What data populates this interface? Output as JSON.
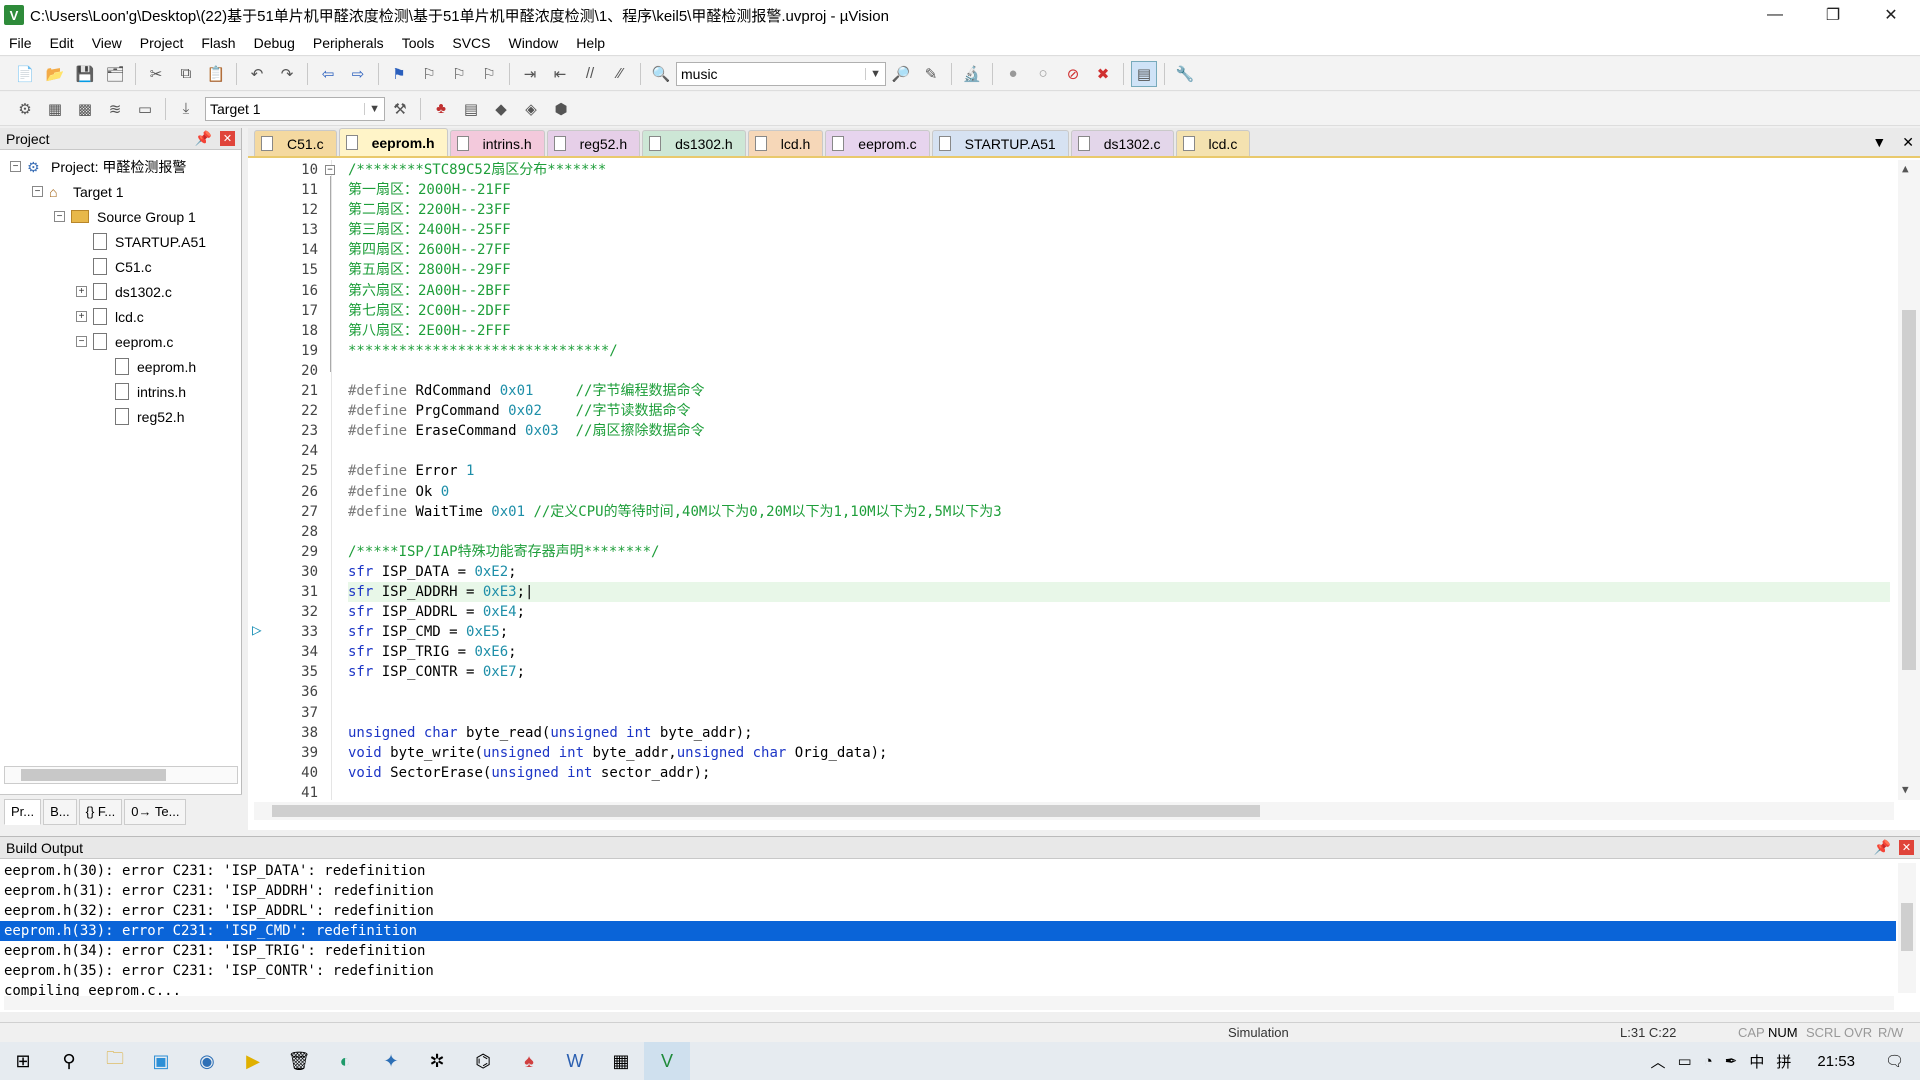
{
  "window": {
    "title": "C:\\Users\\Loon'g\\Desktop\\(22)基于51单片机甲醛浓度检测\\基于51单片机甲醛浓度检测\\1、程序\\keil5\\甲醛检测报警.uvproj - µVision",
    "icon": "V"
  },
  "menu": [
    "File",
    "Edit",
    "View",
    "Project",
    "Flash",
    "Debug",
    "Peripherals",
    "Tools",
    "SVCS",
    "Window",
    "Help"
  ],
  "toolbar": {
    "find_combo": "music"
  },
  "build_toolbar": {
    "target_combo": "Target 1"
  },
  "project_panel": {
    "title": "Project",
    "tree": [
      {
        "label": "Project: 甲醛检测报警",
        "depth": 0,
        "expander": "⊟",
        "icon": "project"
      },
      {
        "label": "Target 1",
        "depth": 1,
        "expander": "⊟",
        "icon": "target"
      },
      {
        "label": "Source Group 1",
        "depth": 2,
        "expander": "⊟",
        "icon": "folder"
      },
      {
        "label": "STARTUP.A51",
        "depth": 3,
        "expander": "",
        "icon": "file"
      },
      {
        "label": "C51.c",
        "depth": 3,
        "expander": "",
        "icon": "file"
      },
      {
        "label": "ds1302.c",
        "depth": 3,
        "expander": "⊞",
        "icon": "file"
      },
      {
        "label": "lcd.c",
        "depth": 3,
        "expander": "⊞",
        "icon": "file"
      },
      {
        "label": "eeprom.c",
        "depth": 3,
        "expander": "⊟",
        "icon": "file"
      },
      {
        "label": "eeprom.h",
        "depth": 4,
        "expander": "",
        "icon": "file"
      },
      {
        "label": "intrins.h",
        "depth": 4,
        "expander": "",
        "icon": "file"
      },
      {
        "label": "reg52.h",
        "depth": 4,
        "expander": "",
        "icon": "file"
      }
    ],
    "tabs": [
      "Pr...",
      "B...",
      "{} F...",
      "0→ Te..."
    ]
  },
  "editor": {
    "tabs": [
      {
        "label": "C51.c",
        "color": "#f4d9a0"
      },
      {
        "label": "eeprom.h",
        "color": "#fff0c0",
        "active": true
      },
      {
        "label": "intrins.h",
        "color": "#f3c9dc"
      },
      {
        "label": "reg52.h",
        "color": "#e6cfe8"
      },
      {
        "label": "ds1302.h",
        "color": "#cde7d6"
      },
      {
        "label": "lcd.h",
        "color": "#f6d7b8"
      },
      {
        "label": "eeprom.c",
        "color": "#e7d4ee"
      },
      {
        "label": "STARTUP.A51",
        "color": "#d6e2f2"
      },
      {
        "label": "ds1302.c",
        "color": "#e3d6ea"
      },
      {
        "label": "lcd.c",
        "color": "#f4e2b0"
      }
    ],
    "current_line": 31,
    "lines": [
      {
        "n": "10",
        "parts": [
          [
            "cm",
            "/********STC89C52扇区分布*******"
          ]
        ]
      },
      {
        "n": "11",
        "parts": [
          [
            "cm",
            "第一扇区：2000H--21FF"
          ]
        ]
      },
      {
        "n": "12",
        "parts": [
          [
            "cm",
            "第二扇区：2200H--23FF"
          ]
        ]
      },
      {
        "n": "13",
        "parts": [
          [
            "cm",
            "第三扇区：2400H--25FF"
          ]
        ]
      },
      {
        "n": "14",
        "parts": [
          [
            "cm",
            "第四扇区：2600H--27FF"
          ]
        ]
      },
      {
        "n": "15",
        "parts": [
          [
            "cm",
            "第五扇区：2800H--29FF"
          ]
        ]
      },
      {
        "n": "16",
        "parts": [
          [
            "cm",
            "第六扇区：2A00H--2BFF"
          ]
        ]
      },
      {
        "n": "17",
        "parts": [
          [
            "cm",
            "第七扇区：2C00H--2DFF"
          ]
        ]
      },
      {
        "n": "18",
        "parts": [
          [
            "cm",
            "第八扇区：2E00H--2FFF"
          ]
        ]
      },
      {
        "n": "19",
        "parts": [
          [
            "cm",
            "*******************************/"
          ]
        ]
      },
      {
        "n": "20",
        "parts": []
      },
      {
        "n": "21",
        "parts": [
          [
            "pp",
            "#define "
          ],
          [
            "t",
            "RdCommand "
          ],
          [
            "num",
            "0x01"
          ],
          [
            "t",
            "     "
          ],
          [
            "cm",
            "//字节编程数据命令"
          ]
        ]
      },
      {
        "n": "22",
        "parts": [
          [
            "pp",
            "#define "
          ],
          [
            "t",
            "PrgCommand "
          ],
          [
            "num",
            "0x02"
          ],
          [
            "t",
            "    "
          ],
          [
            "cm",
            "//字节读数据命令"
          ]
        ]
      },
      {
        "n": "23",
        "parts": [
          [
            "pp",
            "#define "
          ],
          [
            "t",
            "EraseCommand "
          ],
          [
            "num",
            "0x03"
          ],
          [
            "t",
            "  "
          ],
          [
            "cm",
            "//扇区擦除数据命令"
          ]
        ]
      },
      {
        "n": "24",
        "parts": []
      },
      {
        "n": "25",
        "parts": [
          [
            "pp",
            "#define "
          ],
          [
            "t",
            "Error "
          ],
          [
            "num",
            "1"
          ]
        ]
      },
      {
        "n": "26",
        "parts": [
          [
            "pp",
            "#define "
          ],
          [
            "t",
            "Ok "
          ],
          [
            "num",
            "0"
          ]
        ]
      },
      {
        "n": "27",
        "parts": [
          [
            "pp",
            "#define "
          ],
          [
            "t",
            "WaitTime "
          ],
          [
            "num",
            "0x01"
          ],
          [
            "t",
            " "
          ],
          [
            "cm",
            "//定义CPU的等待时间,40M以下为0,20M以下为1,10M以下为2,5M以下为3"
          ]
        ]
      },
      {
        "n": "28",
        "parts": []
      },
      {
        "n": "29",
        "parts": [
          [
            "cm",
            "/*****ISP/IAP特殊功能寄存器声明********/"
          ]
        ]
      },
      {
        "n": "30",
        "parts": [
          [
            "kw",
            "sfr "
          ],
          [
            "t",
            "ISP_DATA = "
          ],
          [
            "num",
            "0xE2"
          ],
          [
            "t",
            ";"
          ]
        ]
      },
      {
        "n": "31",
        "parts": [
          [
            "kw",
            "sfr "
          ],
          [
            "t",
            "ISP_ADDRH = "
          ],
          [
            "num",
            "0xE3"
          ],
          [
            "t",
            ";|"
          ]
        ]
      },
      {
        "n": "32",
        "parts": [
          [
            "kw",
            "sfr "
          ],
          [
            "t",
            "ISP_ADDRL = "
          ],
          [
            "num",
            "0xE4"
          ],
          [
            "t",
            ";"
          ]
        ]
      },
      {
        "n": "33",
        "parts": [
          [
            "kw",
            "sfr "
          ],
          [
            "t",
            "ISP_CMD = "
          ],
          [
            "num",
            "0xE5"
          ],
          [
            "t",
            ";"
          ]
        ]
      },
      {
        "n": "34",
        "parts": [
          [
            "kw",
            "sfr "
          ],
          [
            "t",
            "ISP_TRIG = "
          ],
          [
            "num",
            "0xE6"
          ],
          [
            "t",
            ";"
          ]
        ]
      },
      {
        "n": "35",
        "parts": [
          [
            "kw",
            "sfr "
          ],
          [
            "t",
            "ISP_CONTR = "
          ],
          [
            "num",
            "0xE7"
          ],
          [
            "t",
            ";"
          ]
        ]
      },
      {
        "n": "36",
        "parts": []
      },
      {
        "n": "37",
        "parts": []
      },
      {
        "n": "38",
        "parts": [
          [
            "kw",
            "unsigned char "
          ],
          [
            "t",
            "byte_read("
          ],
          [
            "kw",
            "unsigned int "
          ],
          [
            "t",
            "byte_addr);"
          ]
        ]
      },
      {
        "n": "39",
        "parts": [
          [
            "kw",
            "void "
          ],
          [
            "t",
            "byte_write("
          ],
          [
            "kw",
            "unsigned int "
          ],
          [
            "t",
            "byte_addr,"
          ],
          [
            "kw",
            "unsigned char "
          ],
          [
            "t",
            "Orig_data);"
          ]
        ]
      },
      {
        "n": "40",
        "parts": [
          [
            "kw",
            "void "
          ],
          [
            "t",
            "SectorErase("
          ],
          [
            "kw",
            "unsigned int "
          ],
          [
            "t",
            "sector_addr);"
          ]
        ]
      },
      {
        "n": "41",
        "parts": []
      }
    ]
  },
  "build_output": {
    "title": "Build Output",
    "selected_index": 3,
    "lines": [
      "eeprom.h(30): error C231: 'ISP_DATA': redefinition",
      "eeprom.h(31): error C231: 'ISP_ADDRH': redefinition",
      "eeprom.h(32): error C231: 'ISP_ADDRL': redefinition",
      "eeprom.h(33): error C231: 'ISP_CMD': redefinition",
      "eeprom.h(34): error C231: 'ISP_TRIG': redefinition",
      "eeprom.h(35): error C231: 'ISP_CONTR': redefinition",
      "compiling eeprom.c..."
    ]
  },
  "statusbar": {
    "mode": "Simulation",
    "position": "L:31 C:22",
    "cap": "CAP",
    "num": "NUM",
    "scrl": "SCRL",
    "ovr": "OVR",
    "rw": "R/W"
  },
  "taskbar": {
    "ime": "中",
    "layout": "拼",
    "clock": "21:53"
  }
}
